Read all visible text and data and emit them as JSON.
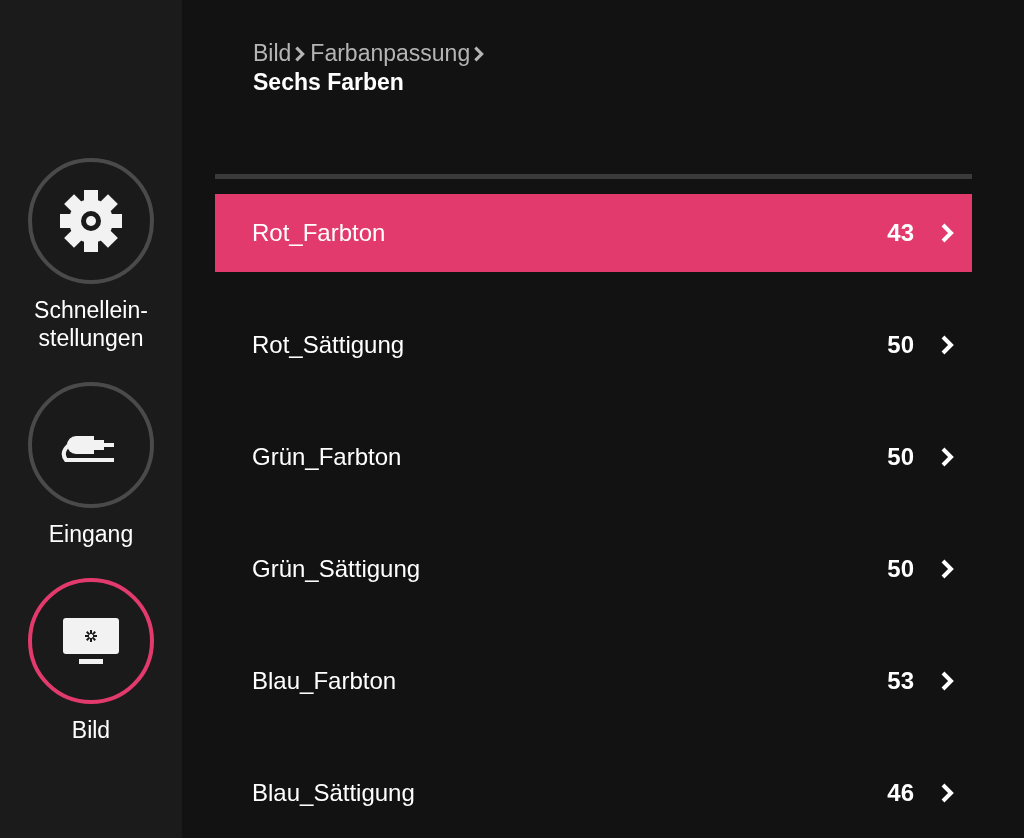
{
  "breadcrumb": {
    "path": [
      "Bild",
      "Farbanpassung"
    ],
    "current": "Sechs Farben"
  },
  "sidebar": {
    "items": [
      {
        "kind": "settings",
        "label": "Schnellein-stellungen",
        "selected": false
      },
      {
        "kind": "input",
        "label": "Eingang",
        "selected": false
      },
      {
        "kind": "picture",
        "label": "Bild",
        "selected": true
      }
    ]
  },
  "menu": {
    "items": [
      {
        "label": "Rot_Farbton",
        "value": "43",
        "selected": true
      },
      {
        "label": "Rot_Sättigung",
        "value": "50",
        "selected": false
      },
      {
        "label": "Grün_Farbton",
        "value": "50",
        "selected": false
      },
      {
        "label": "Grün_Sättigung",
        "value": "50",
        "selected": false
      },
      {
        "label": "Blau_Farbton",
        "value": "53",
        "selected": false
      },
      {
        "label": "Blau_Sättigung",
        "value": "46",
        "selected": false
      }
    ]
  }
}
